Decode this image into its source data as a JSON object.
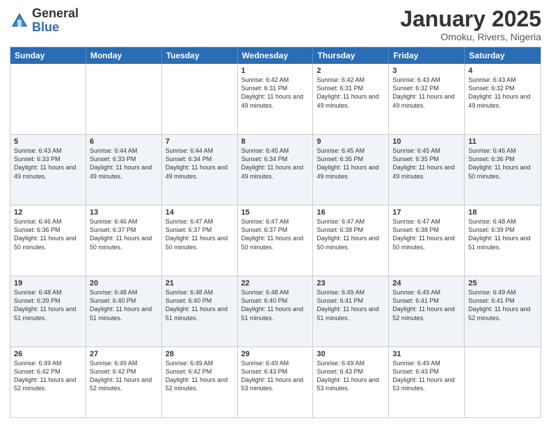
{
  "header": {
    "logo_general": "General",
    "logo_blue": "Blue",
    "month_title": "January 2025",
    "location": "Omoku, Rivers, Nigeria"
  },
  "days_of_week": [
    "Sunday",
    "Monday",
    "Tuesday",
    "Wednesday",
    "Thursday",
    "Friday",
    "Saturday"
  ],
  "weeks": [
    [
      {
        "day": "",
        "info": ""
      },
      {
        "day": "",
        "info": ""
      },
      {
        "day": "",
        "info": ""
      },
      {
        "day": "1",
        "info": "Sunrise: 6:42 AM\nSunset: 6:31 PM\nDaylight: 11 hours\nand 49 minutes."
      },
      {
        "day": "2",
        "info": "Sunrise: 6:42 AM\nSunset: 6:31 PM\nDaylight: 11 hours\nand 49 minutes."
      },
      {
        "day": "3",
        "info": "Sunrise: 6:43 AM\nSunset: 6:32 PM\nDaylight: 11 hours\nand 49 minutes."
      },
      {
        "day": "4",
        "info": "Sunrise: 6:43 AM\nSunset: 6:32 PM\nDaylight: 11 hours\nand 49 minutes."
      }
    ],
    [
      {
        "day": "5",
        "info": "Sunrise: 6:43 AM\nSunset: 6:33 PM\nDaylight: 11 hours\nand 49 minutes."
      },
      {
        "day": "6",
        "info": "Sunrise: 6:44 AM\nSunset: 6:33 PM\nDaylight: 11 hours\nand 49 minutes."
      },
      {
        "day": "7",
        "info": "Sunrise: 6:44 AM\nSunset: 6:34 PM\nDaylight: 11 hours\nand 49 minutes."
      },
      {
        "day": "8",
        "info": "Sunrise: 6:45 AM\nSunset: 6:34 PM\nDaylight: 11 hours\nand 49 minutes."
      },
      {
        "day": "9",
        "info": "Sunrise: 6:45 AM\nSunset: 6:35 PM\nDaylight: 11 hours\nand 49 minutes."
      },
      {
        "day": "10",
        "info": "Sunrise: 6:45 AM\nSunset: 6:35 PM\nDaylight: 11 hours\nand 49 minutes."
      },
      {
        "day": "11",
        "info": "Sunrise: 6:46 AM\nSunset: 6:36 PM\nDaylight: 11 hours\nand 50 minutes."
      }
    ],
    [
      {
        "day": "12",
        "info": "Sunrise: 6:46 AM\nSunset: 6:36 PM\nDaylight: 11 hours\nand 50 minutes."
      },
      {
        "day": "13",
        "info": "Sunrise: 6:46 AM\nSunset: 6:37 PM\nDaylight: 11 hours\nand 50 minutes."
      },
      {
        "day": "14",
        "info": "Sunrise: 6:47 AM\nSunset: 6:37 PM\nDaylight: 11 hours\nand 50 minutes."
      },
      {
        "day": "15",
        "info": "Sunrise: 6:47 AM\nSunset: 6:37 PM\nDaylight: 11 hours\nand 50 minutes."
      },
      {
        "day": "16",
        "info": "Sunrise: 6:47 AM\nSunset: 6:38 PM\nDaylight: 11 hours\nand 50 minutes."
      },
      {
        "day": "17",
        "info": "Sunrise: 6:47 AM\nSunset: 6:38 PM\nDaylight: 11 hours\nand 50 minutes."
      },
      {
        "day": "18",
        "info": "Sunrise: 6:48 AM\nSunset: 6:39 PM\nDaylight: 11 hours\nand 51 minutes."
      }
    ],
    [
      {
        "day": "19",
        "info": "Sunrise: 6:48 AM\nSunset: 6:39 PM\nDaylight: 11 hours\nand 51 minutes."
      },
      {
        "day": "20",
        "info": "Sunrise: 6:48 AM\nSunset: 6:40 PM\nDaylight: 11 hours\nand 51 minutes."
      },
      {
        "day": "21",
        "info": "Sunrise: 6:48 AM\nSunset: 6:40 PM\nDaylight: 11 hours\nand 51 minutes."
      },
      {
        "day": "22",
        "info": "Sunrise: 6:48 AM\nSunset: 6:40 PM\nDaylight: 11 hours\nand 51 minutes."
      },
      {
        "day": "23",
        "info": "Sunrise: 6:49 AM\nSunset: 6:41 PM\nDaylight: 11 hours\nand 51 minutes."
      },
      {
        "day": "24",
        "info": "Sunrise: 6:49 AM\nSunset: 6:41 PM\nDaylight: 11 hours\nand 52 minutes."
      },
      {
        "day": "25",
        "info": "Sunrise: 6:49 AM\nSunset: 6:41 PM\nDaylight: 11 hours\nand 52 minutes."
      }
    ],
    [
      {
        "day": "26",
        "info": "Sunrise: 6:49 AM\nSunset: 6:42 PM\nDaylight: 11 hours\nand 52 minutes."
      },
      {
        "day": "27",
        "info": "Sunrise: 6:49 AM\nSunset: 6:42 PM\nDaylight: 11 hours\nand 52 minutes."
      },
      {
        "day": "28",
        "info": "Sunrise: 6:49 AM\nSunset: 6:42 PM\nDaylight: 11 hours\nand 52 minutes."
      },
      {
        "day": "29",
        "info": "Sunrise: 6:49 AM\nSunset: 6:43 PM\nDaylight: 11 hours\nand 53 minutes."
      },
      {
        "day": "30",
        "info": "Sunrise: 6:49 AM\nSunset: 6:43 PM\nDaylight: 11 hours\nand 53 minutes."
      },
      {
        "day": "31",
        "info": "Sunrise: 6:49 AM\nSunset: 6:43 PM\nDaylight: 11 hours\nand 53 minutes."
      },
      {
        "day": "",
        "info": ""
      }
    ]
  ]
}
